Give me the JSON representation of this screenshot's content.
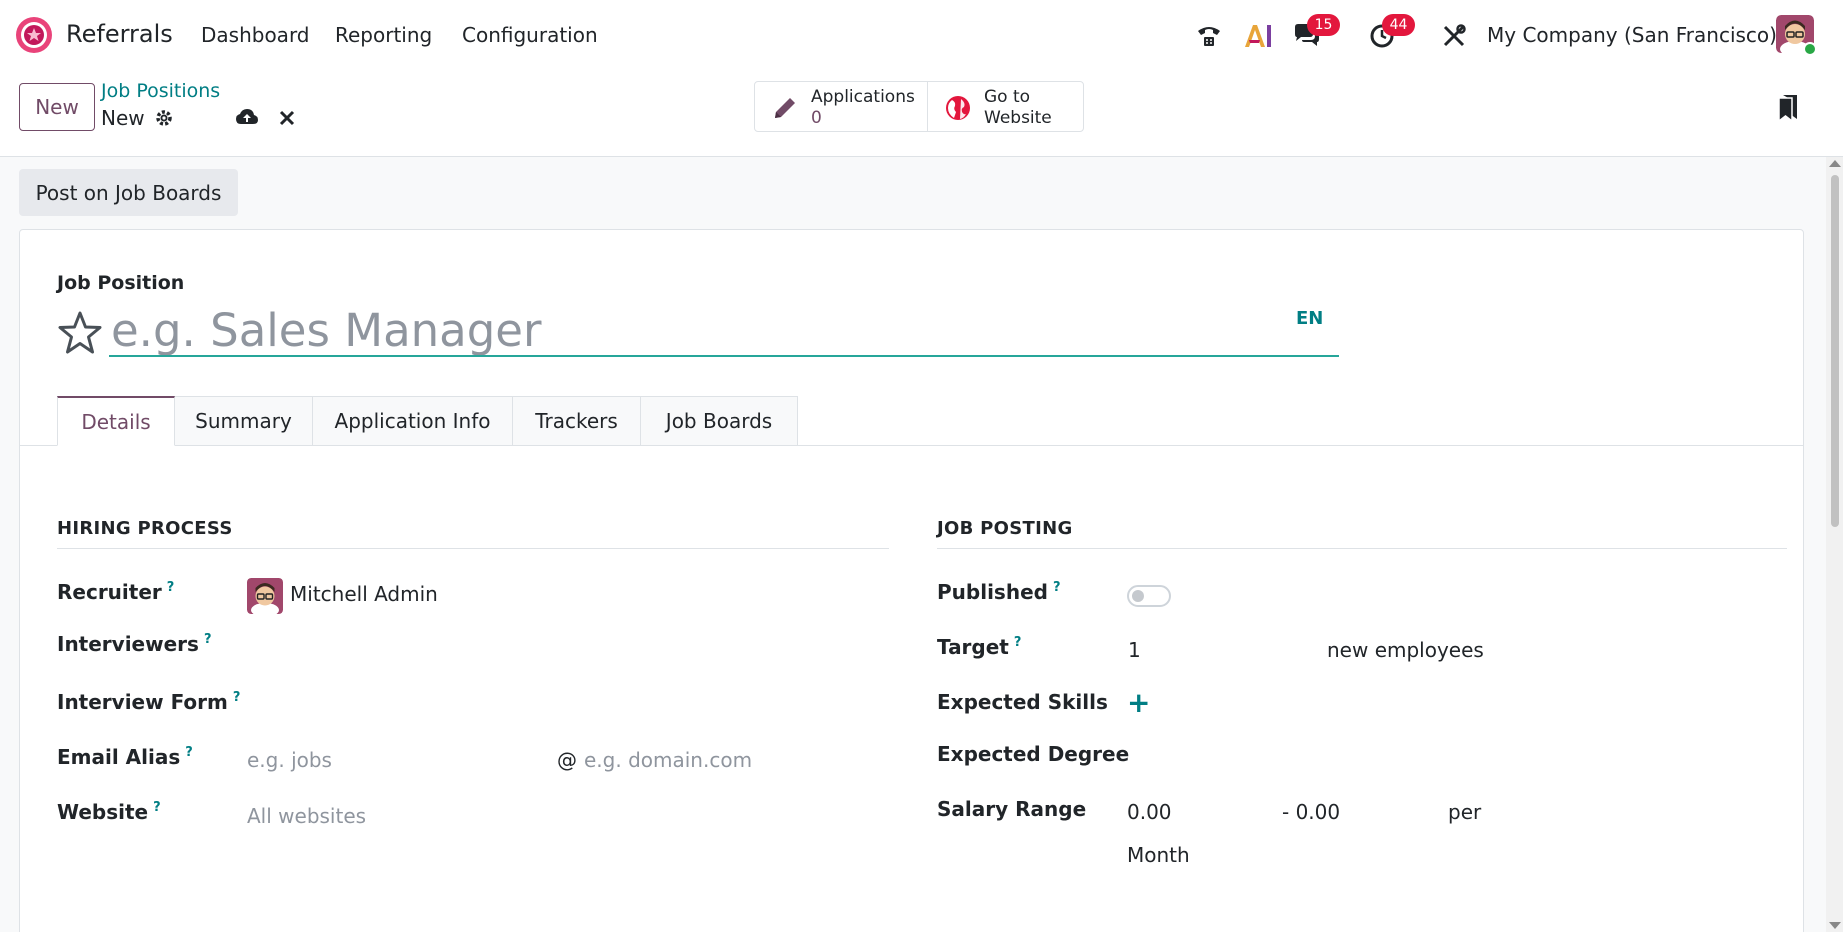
{
  "app": {
    "name": "Referrals",
    "menu": [
      "Dashboard",
      "Reporting",
      "Configuration"
    ],
    "company": "My Company (San Francisco)",
    "messages_count": "15",
    "activities_count": "44",
    "brand_color": "#714B67"
  },
  "control_panel": {
    "new_label": "New",
    "breadcrumb_parent": "Job Positions",
    "breadcrumb_current": "New",
    "applications_label": "Applications",
    "applications_count": "0",
    "website_label_1": "Go to",
    "website_label_2": "Website"
  },
  "form": {
    "post_button": "Post on Job Boards",
    "job_position_label": "Job Position",
    "name_placeholder": "e.g. Sales Manager",
    "lang": "EN",
    "tabs": [
      "Details",
      "Summary",
      "Application Info",
      "Trackers",
      "Job Boards"
    ],
    "hiring": {
      "title": "HIRING PROCESS",
      "recruiter_label": "Recruiter",
      "recruiter_value": "Mitchell Admin",
      "interviewers_label": "Interviewers",
      "interview_form_label": "Interview Form",
      "email_alias_label": "Email Alias",
      "email_alias_placeholder": "e.g. jobs",
      "at": "@",
      "domain_placeholder": "e.g. domain.com",
      "website_label": "Website",
      "website_placeholder": "All websites"
    },
    "posting": {
      "title": "JOB POSTING",
      "published_label": "Published",
      "published": false,
      "target_label": "Target",
      "target_value": "1",
      "target_suffix": "new employees",
      "skills_label": "Expected Skills",
      "degree_label": "Expected Degree",
      "salary_label": "Salary Range",
      "salary_min": "0.00",
      "salary_max": "- 0.00",
      "salary_per": "per",
      "salary_period": "Month"
    },
    "help_mark": "?"
  }
}
